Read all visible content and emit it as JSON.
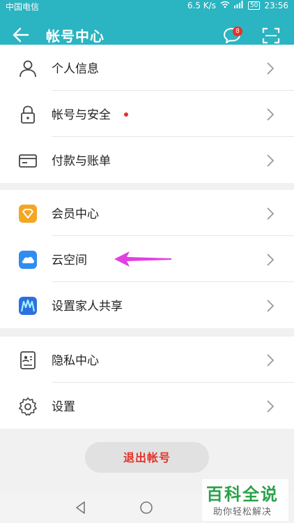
{
  "status_bar": {
    "carrier": "中国电信",
    "speed": "6.5 K/s",
    "battery": "50",
    "time": "23:56"
  },
  "header": {
    "title": "帐号中心",
    "message_badge": "8"
  },
  "groups": [
    {
      "items": [
        {
          "label": "个人信息",
          "icon": "person-icon"
        },
        {
          "label": "帐号与安全",
          "icon": "lock-icon"
        },
        {
          "label": "付款与账单",
          "icon": "card-icon"
        }
      ]
    },
    {
      "items": [
        {
          "label": "会员中心",
          "icon": "member-icon"
        },
        {
          "label": "云空间",
          "icon": "cloud-icon"
        },
        {
          "label": "设置家人共享",
          "icon": "family-share-icon"
        }
      ]
    },
    {
      "items": [
        {
          "label": "隐私中心",
          "icon": "privacy-icon"
        },
        {
          "label": "设置",
          "icon": "gear-icon"
        }
      ]
    }
  ],
  "logout_label": "退出帐号",
  "watermark": {
    "title": "百科全说",
    "subtitle": "助你轻松解决"
  },
  "colors": {
    "accent": "#2bb4c1",
    "danger": "#e4322a",
    "annotation_arrow": "#e23ee2"
  }
}
